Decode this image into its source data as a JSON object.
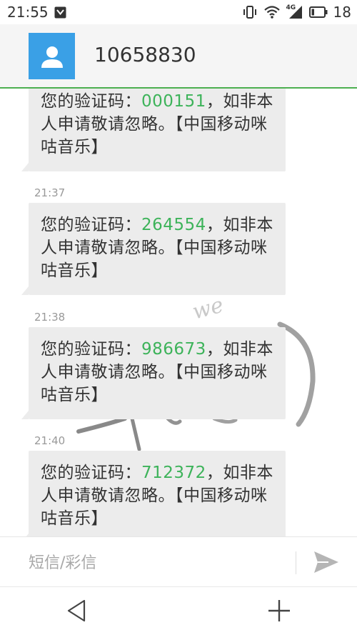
{
  "status_bar": {
    "time": "21:55",
    "network": "4G",
    "battery_level": "18"
  },
  "header": {
    "contact_number": "10658830",
    "avatar_icon": "person-icon"
  },
  "messages": [
    {
      "time": "",
      "text_before": "您的验证码：",
      "code": "000151",
      "text_after": "，如非本人申请敬请忽略。【中国移动咪咕音乐】"
    },
    {
      "time": "21:37",
      "text_before": "您的验证码：",
      "code": "264554",
      "text_after": "，如非本人申请敬请忽略。【中国移动咪咕音乐】"
    },
    {
      "time": "21:38",
      "text_before": "您的验证码：",
      "code": "986673",
      "text_after": "，如非本人申请敬请忽略。【中国移动咪咕音乐】"
    },
    {
      "time": "21:40",
      "text_before": "您的验证码：",
      "code": "712372",
      "text_after": "，如非本人申请敬请忽略。【中国移动咪咕音乐】"
    }
  ],
  "composer": {
    "placeholder": "短信/彩信",
    "send_icon": "send-icon"
  },
  "navbar": {
    "back_icon": "back-triangle-icon",
    "add_icon": "plus-icon"
  },
  "colors": {
    "accent": "#4caf50",
    "code": "#3db35a",
    "avatar": "#3aa0e6",
    "bubble": "#ececec"
  }
}
